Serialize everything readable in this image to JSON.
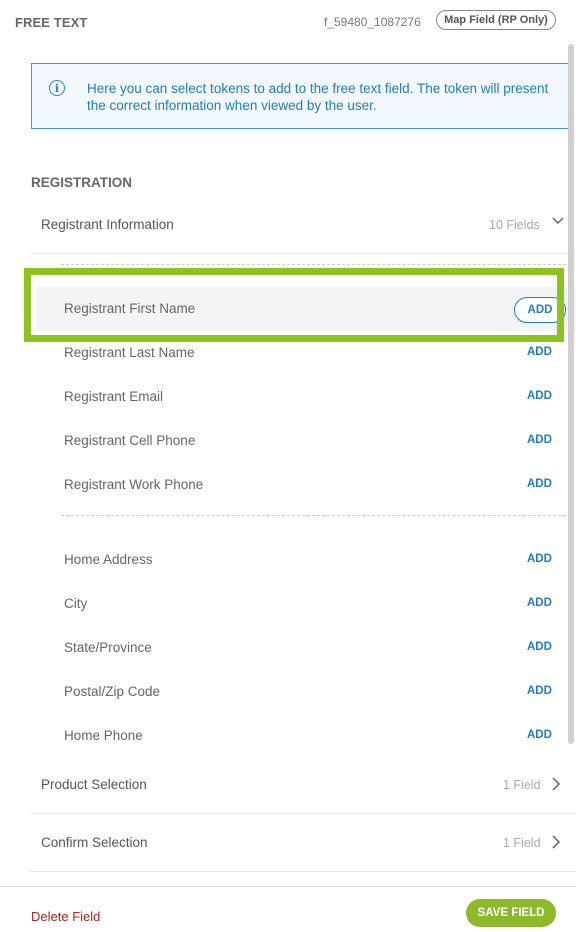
{
  "header": {
    "title": "FREE TEXT",
    "field_id": "f_59480_1087276",
    "map_field_label": "Map Field (RP Only)"
  },
  "info": {
    "text": "Here you can select tokens to add to the free text field. The token will present the correct information when viewed by the user.",
    "icon": "info-icon"
  },
  "section": {
    "title": "REGISTRATION"
  },
  "groups": [
    {
      "label": "Registrant Information",
      "count": "10 Fields",
      "expanded": true,
      "icon": "chevron-down-icon"
    },
    {
      "label": "Product Selection",
      "count": "1 Field",
      "expanded": false,
      "icon": "chevron-right-icon"
    },
    {
      "label": "Confirm Selection",
      "count": "1 Field",
      "expanded": false,
      "icon": "chevron-right-icon"
    }
  ],
  "fields": [
    {
      "label": "Registrant First Name",
      "add": "ADD",
      "highlighted": true
    },
    {
      "label": "Registrant Last Name",
      "add": "ADD"
    },
    {
      "label": "Registrant Email",
      "add": "ADD"
    },
    {
      "label": "Registrant Cell Phone",
      "add": "ADD"
    },
    {
      "label": "Registrant Work Phone",
      "add": "ADD"
    },
    {
      "label": "Home Address",
      "add": "ADD"
    },
    {
      "label": "City",
      "add": "ADD"
    },
    {
      "label": "State/Province",
      "add": "ADD"
    },
    {
      "label": "Postal/Zip Code",
      "add": "ADD"
    },
    {
      "label": "Home Phone",
      "add": "ADD"
    }
  ],
  "footer": {
    "delete_label": "Delete Field",
    "save_label": "SAVE FIELD"
  },
  "colors": {
    "accent_blue": "#1f7dc0",
    "highlight_green": "#8cc31f",
    "save_green": "#8cba2a",
    "delete_red": "#b22222"
  }
}
